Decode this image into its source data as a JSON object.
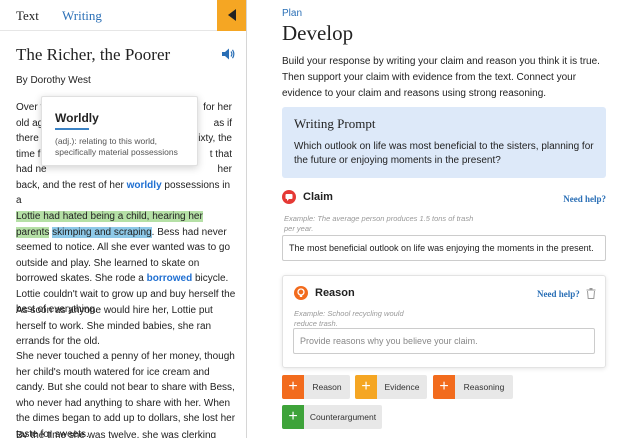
{
  "tabs": {
    "text": "Text",
    "writing": "Writing"
  },
  "story": {
    "title": "The Richer, the Poorer",
    "author": "By Dorothy West",
    "p1": {
      "lines": [
        "Over t",
        "old ag",
        "there ",
        "time f",
        "had ne"
      ],
      "lines_right": [
        "for her",
        "as if",
        "ixty, the",
        "t that",
        "her"
      ],
      "before_vocab": "back, and the rest of her ",
      "vocab": "worldly",
      "after_vocab": " possessions in a",
      "last": "battered suitcase."
    },
    "p2": {
      "hl1": "Lottie had hated being a child, hearing her parents",
      "hl2": "skimping and scraping",
      "rest1": ". Bess had never seemed to",
      "rest2": "notice. All she ever wanted was to go outside and play. She learned to skate on borrowed skates. She rode a ",
      "vocab": "borrowed",
      "rest3": " bicycle. Lottie couldn't wait to grow up and buy herself the best of everything."
    },
    "p3": "As soon as anyone would hire her, Lottie put herself to work. She minded babies, she ran errands for the old.",
    "p4": "She never touched a penny of her money, though her child's mouth watered for ice cream and candy. But she could not bear to share with Bess, who never had anything to share with her. When the dimes began to add up to dollars, she lost her taste for sweets.",
    "p5": "By the time she was twelve, she was clerking after"
  },
  "tooltip": {
    "word": "Worldly",
    "definition": "(adj.): relating to this world, specifically material possessions"
  },
  "plan_link": "Plan",
  "heading": "Develop",
  "intro": "Build your response by writing your claim and reason you think it is true. Then support your claim with evidence from the text. Connect your evidence to your claim and reasons using strong reasoning.",
  "prompt": {
    "title": "Writing Prompt",
    "text": "Which outlook on life was most beneficial to the sisters, planning for the future or enjoying moments in the present?"
  },
  "claim": {
    "label": "Claim",
    "help": "Need help?",
    "example": "Example: The average person produces 1.5 tons of trash per year.",
    "value": "The most beneficial outlook on life was enjoying the moments in the present."
  },
  "reason": {
    "label": "Reason",
    "help": "Need help?",
    "example": "Example: School recycling would reduce trash.",
    "placeholder": "Provide reasons why you believe your claim."
  },
  "add_buttons": {
    "reason": "Reason",
    "evidence": "Evidence",
    "reasoning": "Reasoning",
    "counterargument": "Counterargument"
  },
  "colors": {
    "accent_blue": "#2a6fb6",
    "collapse_orange": "#f5a623",
    "claim_red": "#e53935",
    "reason_orange": "#f26b1d",
    "counter_green": "#3ea33a",
    "prompt_bg": "#dde9f9",
    "highlight_green": "#b5e0a6"
  }
}
